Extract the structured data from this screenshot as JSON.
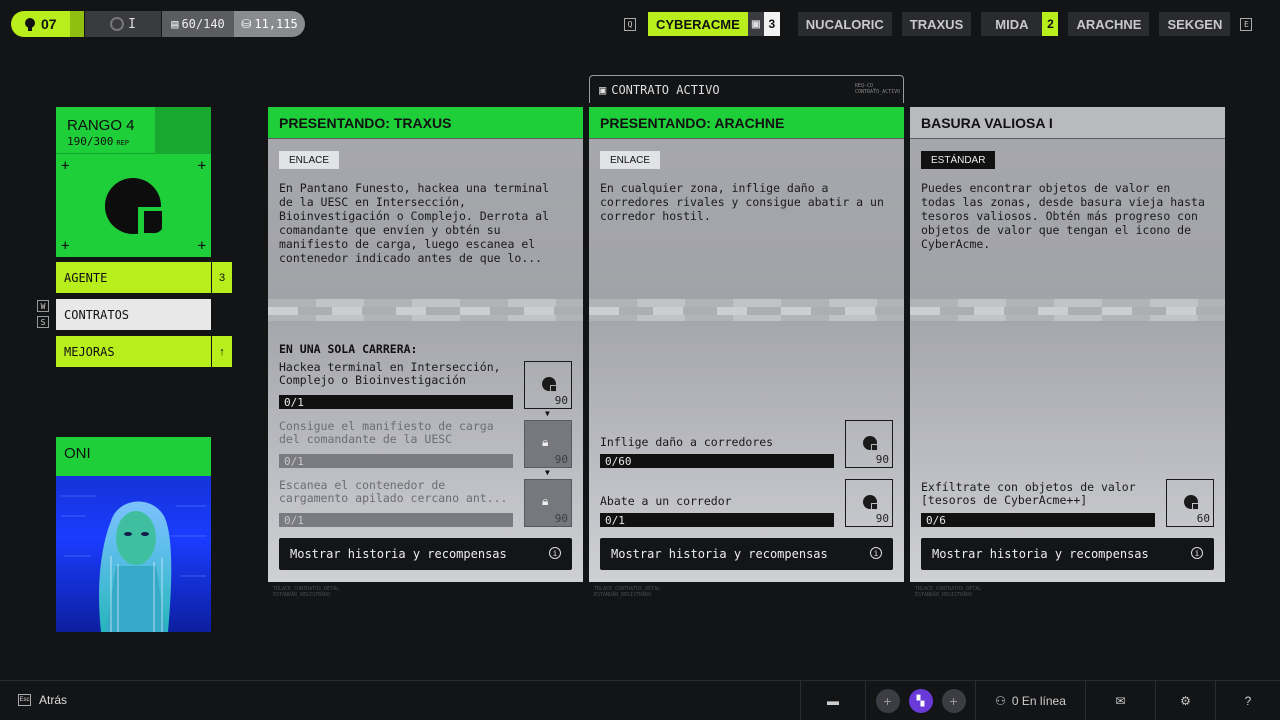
{
  "topbar": {
    "level": "07",
    "prestige": "I",
    "capacity": "60/140",
    "credits": "11,115",
    "left_key": "Q",
    "right_key": "E",
    "factions": [
      {
        "label": "CYBERACME",
        "active": true,
        "badge": "3"
      },
      {
        "label": "NUCALORIC",
        "active": false
      },
      {
        "label": "TRAXUS",
        "active": false
      },
      {
        "label": "MIDA",
        "active": false,
        "badge": "2"
      },
      {
        "label": "ARACHNE",
        "active": false
      },
      {
        "label": "SEKGEN",
        "active": false
      }
    ]
  },
  "rank": {
    "title": "RANGO 4",
    "rep": "190/300",
    "rep_unit": "REP"
  },
  "menu": {
    "agent": "AGENTE",
    "agent_badge": "3",
    "contracts": "CONTRATOS",
    "upgrades": "MEJORAS",
    "key_w": "W",
    "key_s": "S"
  },
  "agent": {
    "name": "ONI"
  },
  "active_contract": {
    "label": "CONTRATO ACTIVO",
    "code": "REQ-CO_ CONTRATO_ACTIVO"
  },
  "cards": [
    {
      "title": "PRESENTANDO: TRAXUS",
      "tag": "ENLACE",
      "description": "En Pantano Funesto, hackea una terminal de la UESC en Intersección, Bioinvestigación o Complejo. Derrota al comandante que envíen y obtén su manifiesto de carga, luego escanea el contenedor indicado antes de que lo...",
      "section": "EN UNA SOLA CARRERA:",
      "objectives": [
        {
          "text": "Hackea terminal en Intersección, Complejo o Bioinvestigación",
          "progress": "0/1",
          "reward": "90",
          "locked": false
        },
        {
          "text": "Consigue el manifiesto de carga del comandante de la UESC",
          "progress": "0/1",
          "reward": "90",
          "locked": true
        },
        {
          "text": "Escanea el contenedor de cargamento apilado cercano ant...",
          "progress": "0/1",
          "reward": "90",
          "locked": true
        }
      ],
      "button": "Mostrar historia y recompensas",
      "footer": "TRLACE_CONTRATOS_DETAL ESTANDAR_REGISTRADO"
    },
    {
      "title": "PRESENTANDO: ARACHNE",
      "tag": "ENLACE",
      "description": "En cualquier zona, inflige daño a corredores rivales y consigue abatir a un corredor hostil.",
      "objectives": [
        {
          "text": "Inflige daño a corredores",
          "progress": "0/60",
          "reward": "90",
          "locked": false
        },
        {
          "text": "Abate a un corredor",
          "progress": "0/1",
          "reward": "90",
          "locked": false
        }
      ],
      "button": "Mostrar historia y recompensas",
      "footer": "TRLACE_CONTRATOS_DETAL ESTANDAR_REGISTRADO"
    },
    {
      "title": "BASURA VALIOSA I",
      "tag": "ESTÁNDAR",
      "description": "Puedes encontrar objetos de valor en todas las zonas, desde basura vieja hasta tesoros valiosos. Obtén más progreso con objetos de valor que tengan el icono de CyberAcme.",
      "objectives": [
        {
          "text": "Exfíltrate con objetos de valor [tesoros de CyberAcme++]",
          "progress": "0/6",
          "reward": "60",
          "locked": false
        }
      ],
      "button": "Mostrar historia y recompensas",
      "footer": "TRLACE_CONTRATOS_DETAL ESTANDAR_REGISTRADO"
    }
  ],
  "bottombar": {
    "back": "Atrás",
    "back_key": "Esc",
    "online": "0 En línea",
    "help": "?"
  },
  "colors": {
    "lime": "#b8ee1c",
    "green": "#1fcf3a",
    "dark": "#131416"
  }
}
